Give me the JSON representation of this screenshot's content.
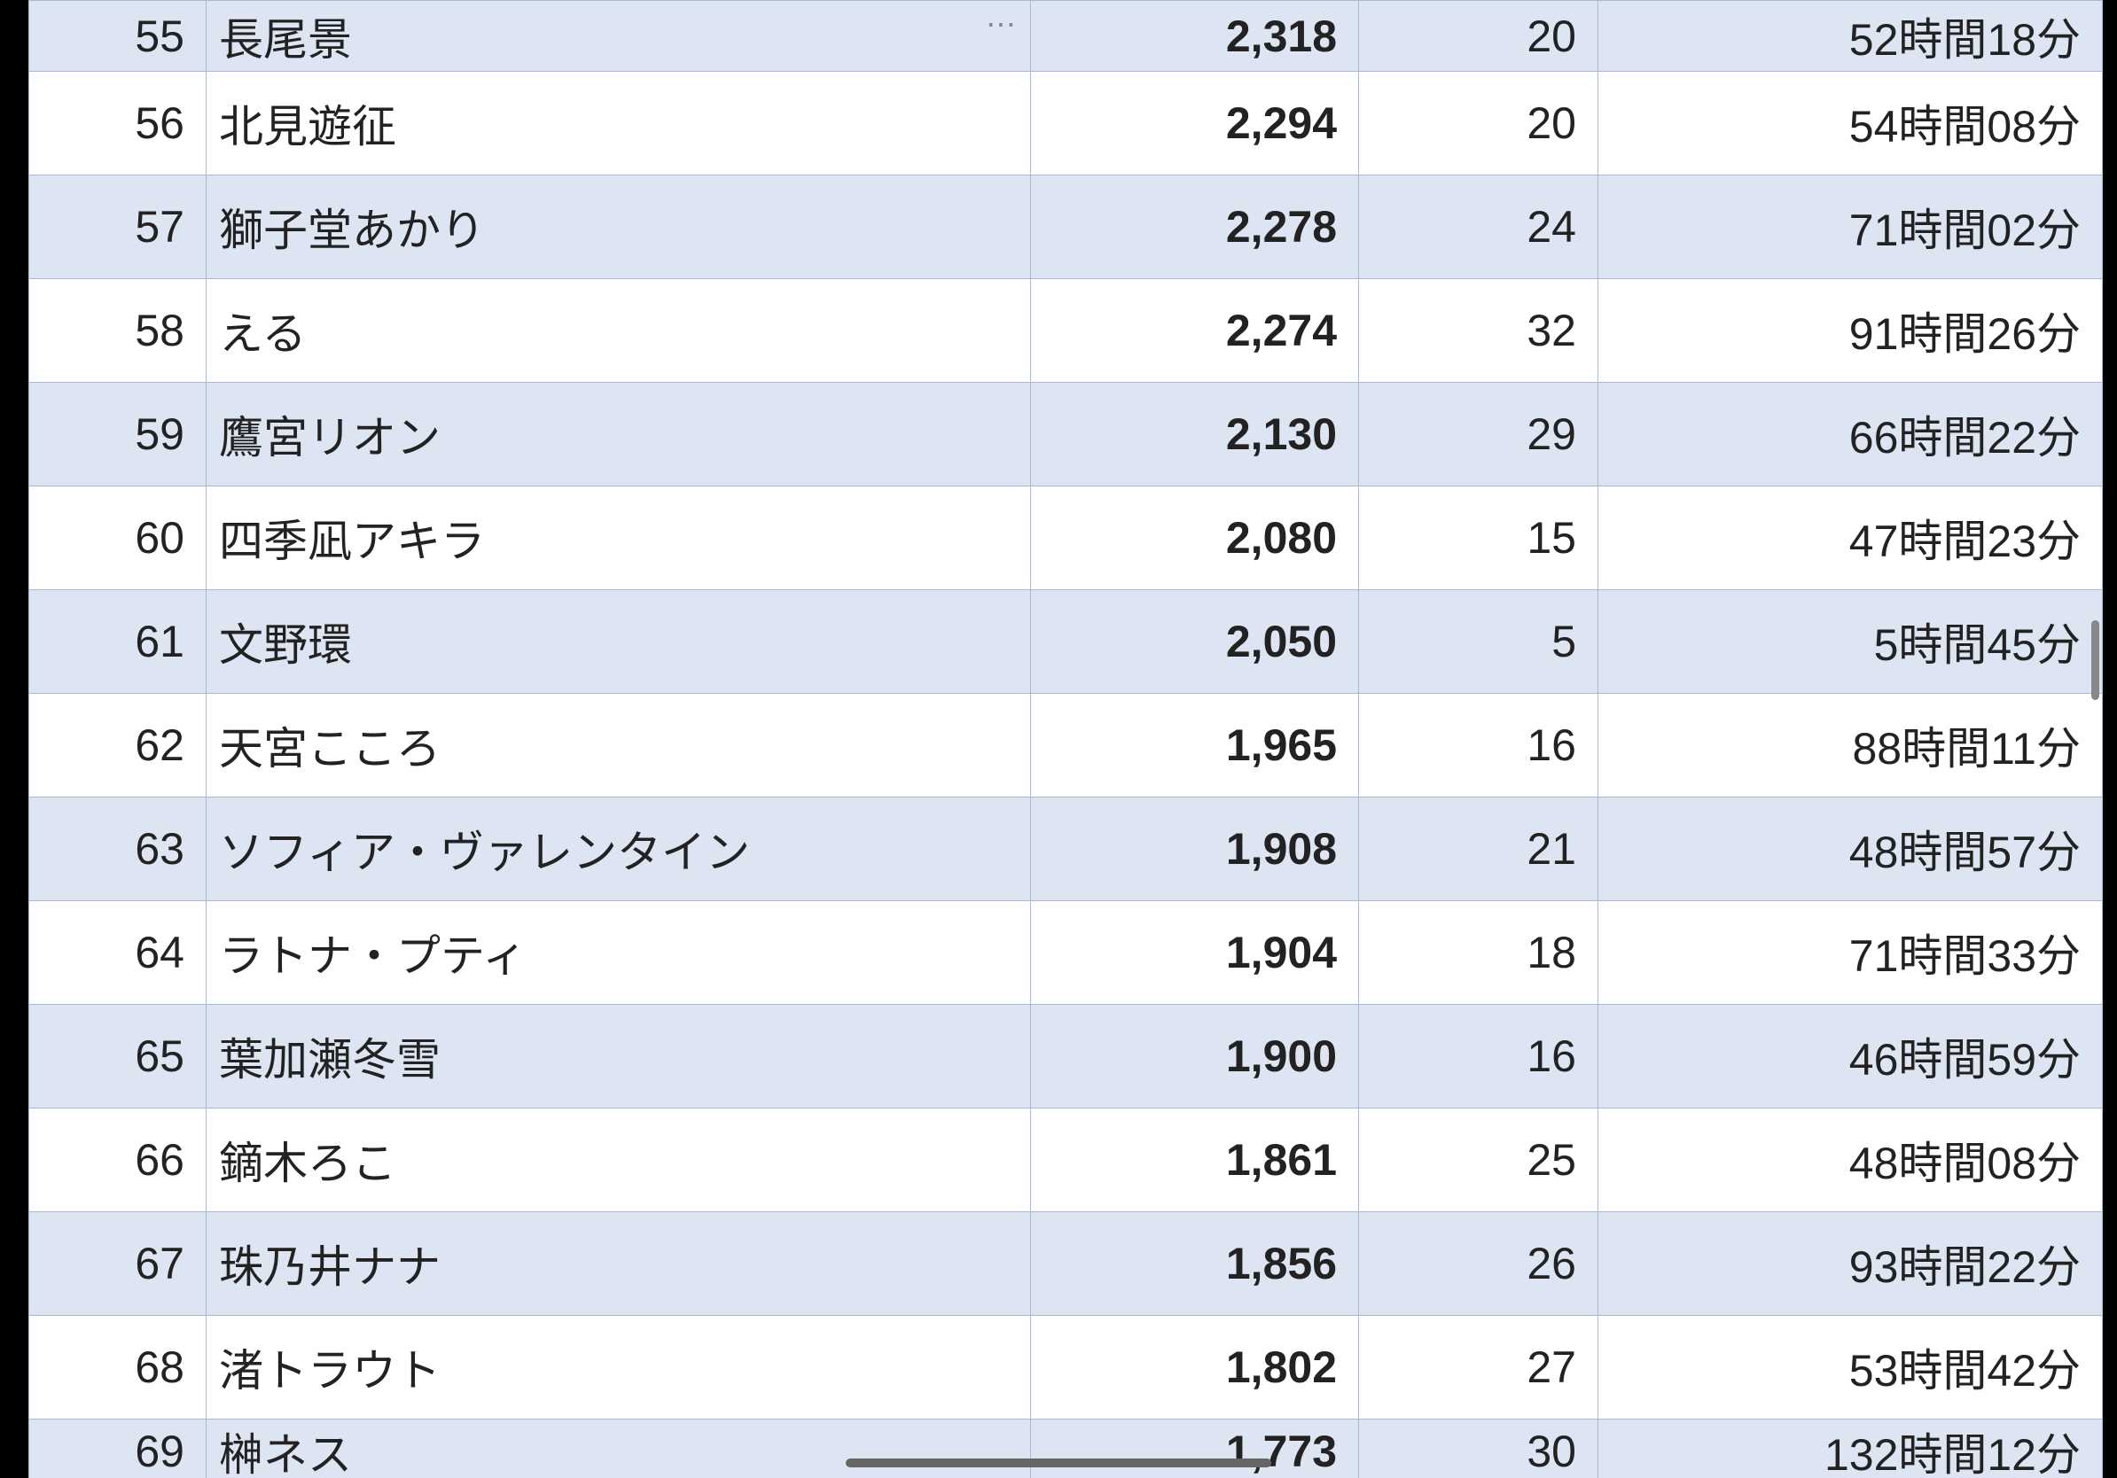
{
  "rows": [
    {
      "rank": "55",
      "name": "長尾景",
      "points": "2,318",
      "count": "20",
      "time": "52時間18分",
      "showEllipsis": true,
      "partial": "top"
    },
    {
      "rank": "56",
      "name": "北見遊征",
      "points": "2,294",
      "count": "20",
      "time": "54時間08分"
    },
    {
      "rank": "57",
      "name": "獅子堂あかり",
      "points": "2,278",
      "count": "24",
      "time": "71時間02分"
    },
    {
      "rank": "58",
      "name": "える",
      "points": "2,274",
      "count": "32",
      "time": "91時間26分"
    },
    {
      "rank": "59",
      "name": "鷹宮リオン",
      "points": "2,130",
      "count": "29",
      "time": "66時間22分"
    },
    {
      "rank": "60",
      "name": "四季凪アキラ",
      "points": "2,080",
      "count": "15",
      "time": "47時間23分"
    },
    {
      "rank": "61",
      "name": "文野環",
      "points": "2,050",
      "count": "5",
      "time": "5時間45分"
    },
    {
      "rank": "62",
      "name": "天宮こころ",
      "points": "1,965",
      "count": "16",
      "time": "88時間11分"
    },
    {
      "rank": "63",
      "name": "ソフィア・ヴァレンタイン",
      "points": "1,908",
      "count": "21",
      "time": "48時間57分"
    },
    {
      "rank": "64",
      "name": "ラトナ・プティ",
      "points": "1,904",
      "count": "18",
      "time": "71時間33分"
    },
    {
      "rank": "65",
      "name": "葉加瀬冬雪",
      "points": "1,900",
      "count": "16",
      "time": "46時間59分"
    },
    {
      "rank": "66",
      "name": "鏑木ろこ",
      "points": "1,861",
      "count": "25",
      "time": "48時間08分"
    },
    {
      "rank": "67",
      "name": "珠乃井ナナ",
      "points": "1,856",
      "count": "26",
      "time": "93時間22分"
    },
    {
      "rank": "68",
      "name": "渚トラウト",
      "points": "1,802",
      "count": "27",
      "time": "53時間42分"
    },
    {
      "rank": "69",
      "name": "榊ネス",
      "points": "1,773",
      "count": "30",
      "time": "132時間12分",
      "partial": "bottom"
    }
  ],
  "ellipsisGlyph": "⋯"
}
